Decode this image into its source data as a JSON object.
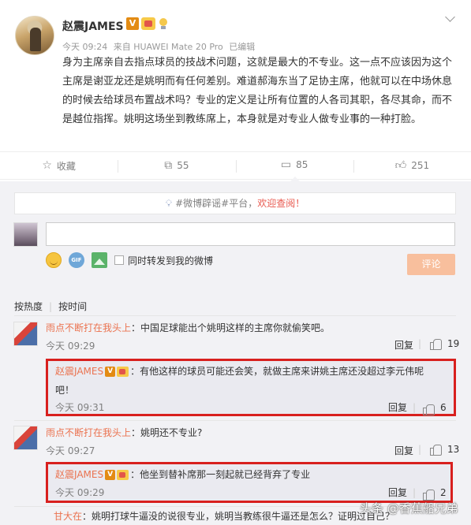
{
  "post": {
    "username": "赵震JAMES",
    "verified_badge": "V",
    "time": "今天 09:24",
    "source": "来自 HUAWEI Mate 20 Pro",
    "edited": "已编辑",
    "text": "身为主席亲自去指点球员的技战术问题，这就是最大的不专业。这一点不应该因为这个主席是谢亚龙还是姚明而有任何差别。难道郝海东当了足协主席，他就可以在中场休息的时候去给球员布置战术吗？专业的定义是让所有位置的人各司其职，各尽其命，而不是越位指挥。姚明这场坐到教练席上，本身就是对专业人做专业事的一种打脸。"
  },
  "actions": [
    {
      "icon": "star-icon",
      "label": "收藏"
    },
    {
      "icon": "share-icon",
      "label": "55"
    },
    {
      "icon": "comment-icon",
      "label": "85"
    },
    {
      "icon": "thumb-up-icon",
      "label": "251"
    }
  ],
  "comments_area": {
    "notice_pre": "#微博辟谣#平台，",
    "notice_link": "欢迎查阅！",
    "input_placeholder": "",
    "repost_label": "同时转发到我的微博",
    "submit_label": "评论",
    "sort_hot": "按热度",
    "sort_time": "按时间"
  },
  "comments": [
    {
      "name": "雨点不断打在我头上",
      "text": "：中国足球能出个姚明这样的主席你就偷笑吧。",
      "time": "今天 09:29",
      "reply": "回复",
      "likes": "19"
    },
    {
      "name": "赵震JAMES",
      "text": "：有他这样的球员可能还会笑，就做主席来讲姚主席还没超过李元伟呢",
      "text2": "吧！",
      "time": "今天 09:31",
      "reply": "回复",
      "likes": "6"
    },
    {
      "name": "雨点不断打在我头上",
      "text": "：姚明还不专业?",
      "time": "今天 09:27",
      "reply": "回复",
      "likes": "13"
    },
    {
      "name": "赵震JAMES",
      "text": "：他坐到替补席那一刻起就已经背弃了专业",
      "time": "今天 09:29",
      "reply": "回复",
      "likes": "2"
    },
    {
      "name": "甘大在",
      "text": "：姚明打球牛逼没的说很专业，姚明当教练很牛逼还是怎么？证明过自己？"
    }
  ],
  "watermark": "头条 @香蕉船兄弟",
  "colors": {
    "link": "#eb7350",
    "highlight_border": "#d8201e",
    "submit_bg": "#f8bf9d"
  }
}
